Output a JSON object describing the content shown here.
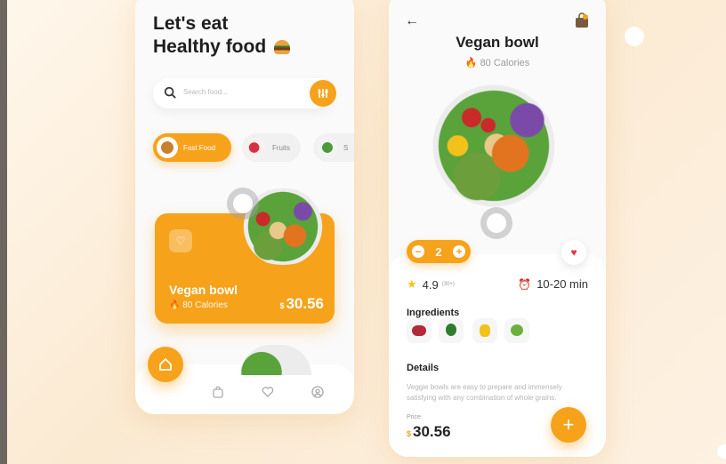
{
  "home": {
    "heading_line1": "Let's eat",
    "heading_line2": "Healthy food",
    "search_placeholder": "Search food...",
    "categories": [
      {
        "label": "Fast Food",
        "active": true
      },
      {
        "label": "Fruits",
        "active": false
      },
      {
        "label": "S",
        "active": false
      }
    ],
    "featured": {
      "name": "Vegan bowl",
      "calories": "80 Calories",
      "currency": "$",
      "price": "30.56"
    },
    "nav_icons": [
      "home-icon",
      "bag-icon",
      "heart-icon",
      "profile-icon"
    ]
  },
  "detail": {
    "title": "Vegan bowl",
    "calories": "80 Calories",
    "quantity": "2",
    "rating": "4.9",
    "rating_sub": "(30+)",
    "time": "10-20 min",
    "ingredients_heading": "Ingredients",
    "ingredient_icons": [
      "meat-icon",
      "broccoli-icon",
      "pepper-icon",
      "lettuce-icon"
    ],
    "details_heading": "Details",
    "description": "Veggie bowls are easy to prepare and immensely satisfying with any combination of whole grains.",
    "price_label": "Price",
    "currency": "$",
    "price": "30.56",
    "add_label": "+"
  },
  "colors": {
    "accent": "#f6a21b",
    "heart": "#e23b3b"
  }
}
